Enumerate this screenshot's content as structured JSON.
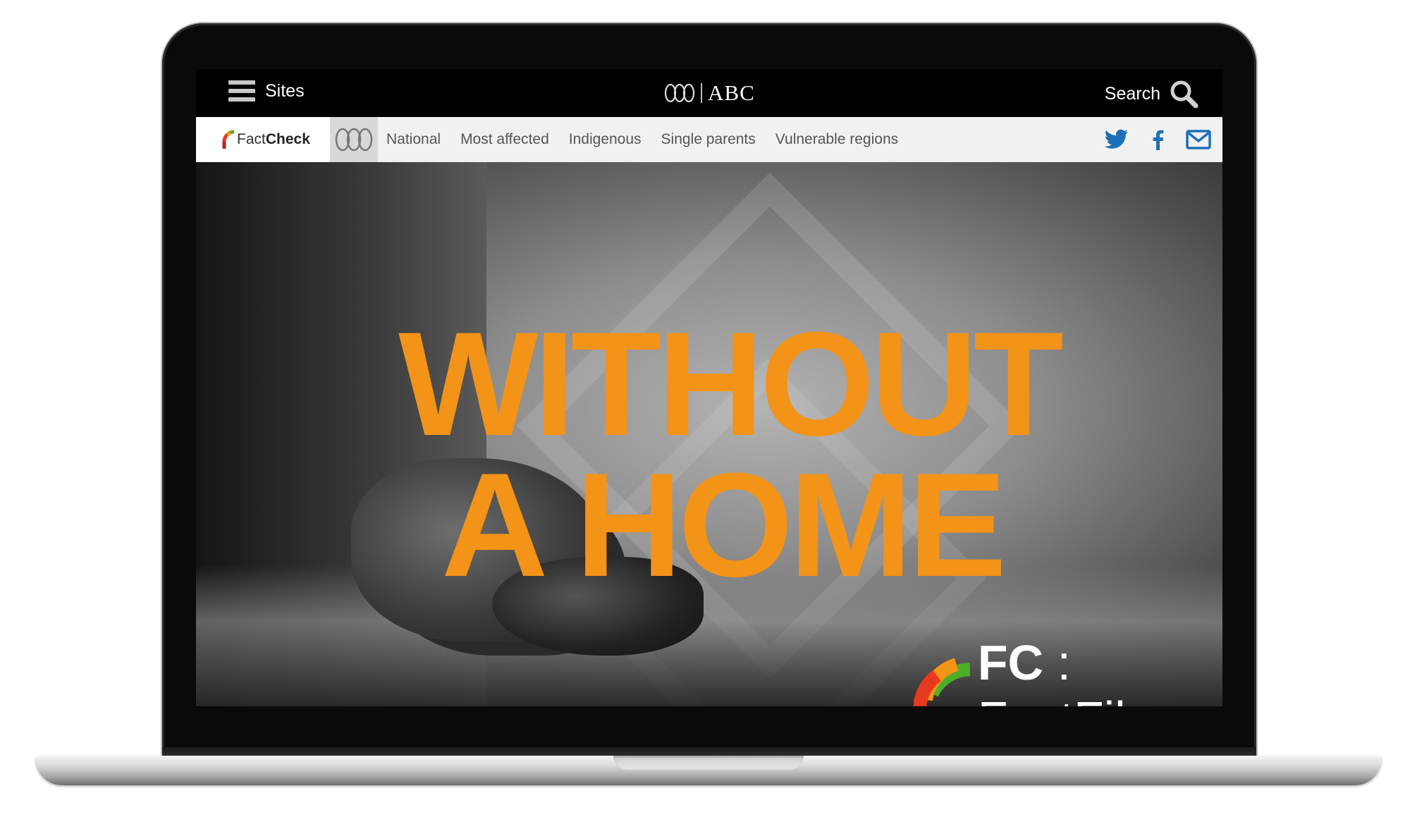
{
  "top_bar": {
    "menu_label": "Sites",
    "logo_text": "ABC",
    "search_label": "Search"
  },
  "factcheck_nav": {
    "logo_prefix": "Fact",
    "logo_suffix": "Check",
    "items": [
      {
        "label": "National"
      },
      {
        "label": "Most affected"
      },
      {
        "label": "Indigenous"
      },
      {
        "label": "Single parents"
      },
      {
        "label": "Vulnerable regions"
      }
    ],
    "share": [
      "twitter-icon",
      "facebook-icon",
      "email-icon"
    ]
  },
  "hero": {
    "title_line1": "WITHOUT",
    "title_line2": "A HOME",
    "badge_prefix": "FC",
    "badge_separator": ":",
    "badge_label": "FactFile"
  },
  "colors": {
    "accent_orange": "#f39317",
    "twitter_blue": "#1d6fb8",
    "nav_bg": "#f1f1f1"
  }
}
